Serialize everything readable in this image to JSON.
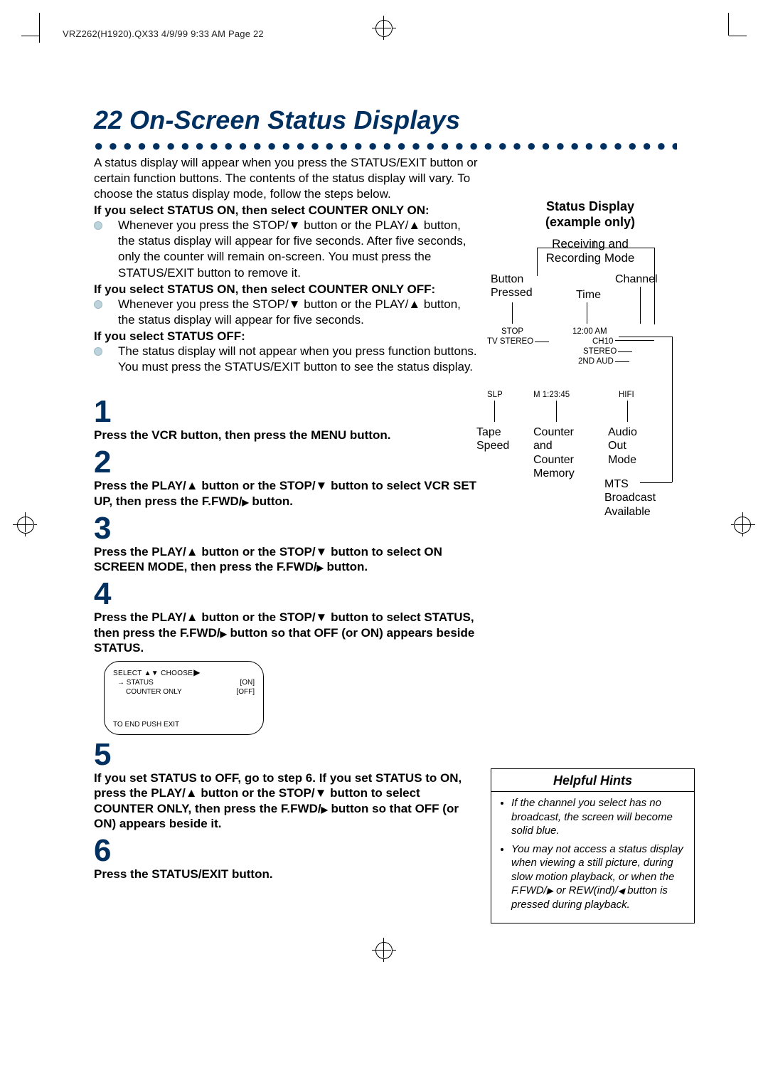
{
  "header": "VRZ262(H1920).QX33  4/9/99 9:33 AM  Page 22",
  "page_number": "22",
  "title": "On-Screen Status Displays",
  "intro": "A status display will appear when you press the STATUS/EXIT button or certain function buttons. The contents of the status display will vary. To choose the status display mode, follow the steps below.",
  "sections": [
    {
      "heading": "If you select STATUS ON, then select COUNTER ONLY ON:",
      "bullet": "Whenever you press the STOP/▼ button or the PLAY/▲ button, the status display will appear for five seconds. After five seconds, only the counter will remain on-screen. You must press the STATUS/EXIT button to remove it."
    },
    {
      "heading": "If you select STATUS ON, then select COUNTER ONLY OFF:",
      "bullet": "Whenever you press the STOP/▼ button or the PLAY/▲ button, the status display will appear for five seconds."
    },
    {
      "heading": "If you select STATUS OFF:",
      "bullet": "The status display will not appear when you press function buttons. You must press the STATUS/EXIT button to see the status display."
    }
  ],
  "steps": {
    "s1": "Press the VCR button, then press the MENU button.",
    "s2a": "Press the PLAY/▲ button or the STOP/▼ button to select VCR SET UP, then press the F.FWD/",
    "s2b": " button.",
    "s3a": "Press the PLAY/▲ button or the STOP/▼ button to select ON SCREEN MODE, then press the F.FWD/",
    "s3b": " button.",
    "s4a": "Press the PLAY/▲ button or the STOP/▼ button to select STATUS, then press the F.FWD/",
    "s4b": " button so that OFF (or ON) appears beside STATUS.",
    "s5a": "If you set STATUS to OFF, go to step 6. If you set STATUS to ON, press the PLAY/▲ button or the STOP/▼ button to select COUNTER ONLY, then press the F.FWD/",
    "s5b": " button so that OFF (or ON) appears beside it.",
    "s6": "Press the STATUS/EXIT button"
  },
  "menu": {
    "title": "SELECT ▲▼ CHOOSE",
    "row1_left": "→ STATUS",
    "row1_right": "[ON]",
    "row2_left": "COUNTER ONLY",
    "row2_right": "[OFF]",
    "footer": "TO END PUSH EXIT"
  },
  "status_display": {
    "title": "Status Display",
    "subtitle": "(example only)",
    "receiving": "Receiving and Recording Mode",
    "button_pressed": "Button Pressed",
    "channel": "Channel",
    "time": "Time",
    "stop": "STOP",
    "tv_stereo": "TV STEREO",
    "clock": "12:00 AM",
    "ch": "CH10",
    "stereo": "STEREO",
    "second_aud": "2ND AUD",
    "slp": "SLP",
    "counter_val": "M  1:23:45",
    "hifi": "HIFI",
    "tape_speed": "Tape Speed",
    "counter_mem": "Counter and Counter Memory",
    "audio_out": "Audio Out Mode",
    "mts": "MTS Broadcast Available"
  },
  "hints": {
    "title": "Helpful Hints",
    "item1": "If the channel you select has no broadcast, the screen will become solid blue.",
    "item2a": "You may not access a status display when viewing a still picture, during slow motion playback, or when the F.FWD/",
    "item2b": " or REW(ind)/",
    "item2c": " button is pressed during playback."
  }
}
